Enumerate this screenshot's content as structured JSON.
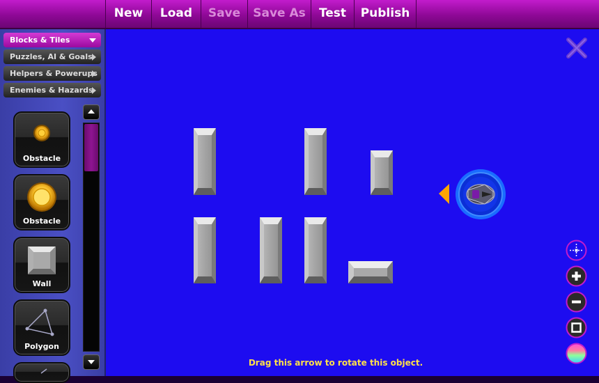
{
  "menu": {
    "new": "New",
    "load": "Load",
    "save": "Save",
    "save_as": "Save As",
    "test": "Test",
    "publish": "Publish"
  },
  "categories": [
    {
      "label": "Blocks & Tiles",
      "expanded": true
    },
    {
      "label": "Puzzles, AI & Goals",
      "expanded": false
    },
    {
      "label": "Helpers & Powerups",
      "expanded": false
    },
    {
      "label": "Enemies & Hazards",
      "expanded": false
    }
  ],
  "palette": [
    {
      "label": "Obstacle",
      "icon": "small-orb-icon"
    },
    {
      "label": "Obstacle",
      "icon": "large-orb-icon"
    },
    {
      "label": "Wall",
      "icon": "wall-block-icon"
    },
    {
      "label": "Polygon",
      "icon": "polygon-icon"
    }
  ],
  "canvas": {
    "hint": "Drag this arrow to rotate this object.",
    "objects": [
      "wall-block",
      "wall-block",
      "wall-block",
      "wall-block",
      "wall-block",
      "wall-block",
      "wall-block",
      "player-ship"
    ]
  },
  "tools": [
    "close-icon",
    "center-view-icon",
    "zoom-in-icon",
    "zoom-out-icon",
    "fit-view-icon",
    "color-picker-icon"
  ],
  "colors": {
    "menu_bar": "#9b0a9f",
    "canvas": "#1d0cf0",
    "hint_text": "#ffe04a",
    "rotate_arrow": "#ffa500",
    "active_category": "#c21ccc"
  }
}
